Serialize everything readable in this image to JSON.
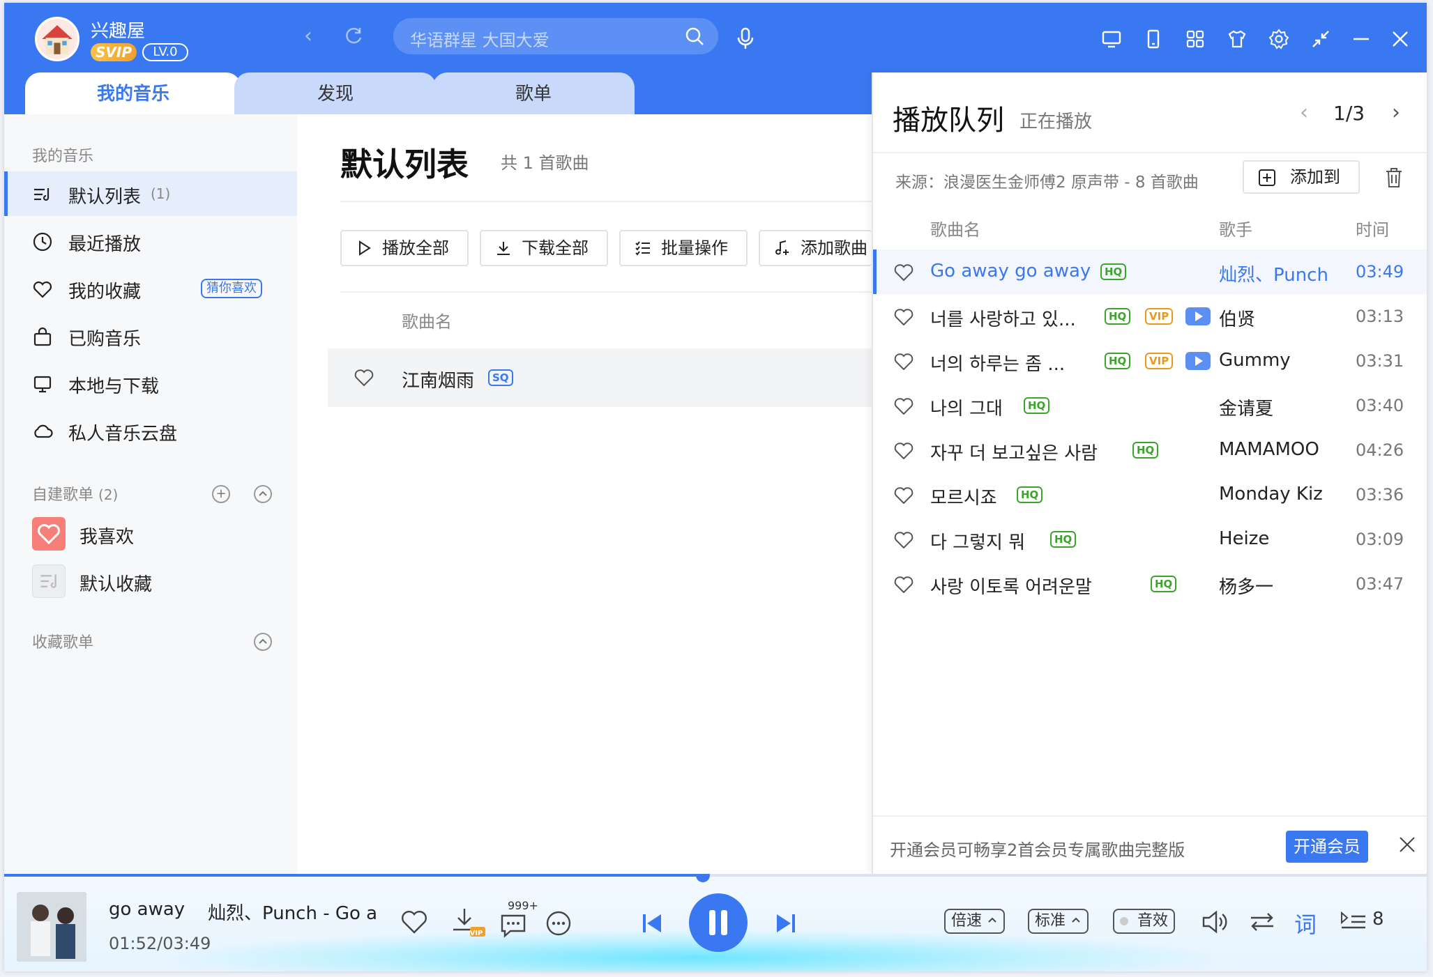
{
  "user": {
    "name": "兴趣屋",
    "svip": "SVIP",
    "level": "LV.0"
  },
  "search": {
    "placeholder": "华语群星 大国大爱"
  },
  "tabs": [
    {
      "label": "我的音乐"
    },
    {
      "label": "发现"
    },
    {
      "label": "歌单"
    }
  ],
  "sidebar": {
    "section_label": "我的音乐",
    "items": [
      {
        "label": "默认列表",
        "count": "(1)"
      },
      {
        "label": "最近播放"
      },
      {
        "label": "我的收藏",
        "tag": "猜你喜欢"
      },
      {
        "label": "已购音乐"
      },
      {
        "label": "本地与下载"
      },
      {
        "label": "私人音乐云盘"
      }
    ],
    "custom_label": "自建歌单",
    "custom_count": "(2)",
    "playlists": [
      {
        "label": "我喜欢"
      },
      {
        "label": "默认收藏"
      }
    ],
    "collected_label": "收藏歌单"
  },
  "main": {
    "title": "默认列表",
    "count": "共 1 首歌曲",
    "actions": [
      "播放全部",
      "下载全部",
      "批量操作",
      "添加歌曲"
    ],
    "column_name": "歌曲名",
    "songs": [
      {
        "name": "江南烟雨",
        "quality": "SQ"
      }
    ]
  },
  "queue": {
    "title": "播放队列",
    "subtitle": "正在播放",
    "page": "1/3",
    "source": "来源：浪漫医生金师傅2 原声带 - 8 首歌曲",
    "add_label": "添加到",
    "col_name": "歌曲名",
    "col_artist": "歌手",
    "col_time": "时间",
    "rows": [
      {
        "name": "Go away go away",
        "artist": "灿烈、Punch",
        "time": "03:49",
        "hq": "HQ",
        "playing": true
      },
      {
        "name": "너를 사랑하고 있...",
        "artist": "伯贤",
        "time": "03:13",
        "hq": "HQ",
        "vip": "VIP",
        "mv": true
      },
      {
        "name": "너의 하루는 좀 ...",
        "artist": "Gummy",
        "time": "03:31",
        "hq": "HQ",
        "vip": "VIP",
        "mv": true
      },
      {
        "name": "나의 그대",
        "artist": "金请夏",
        "time": "03:40",
        "hq": "HQ"
      },
      {
        "name": "자꾸 더 보고싶은 사람",
        "artist": "MAMAMOO",
        "time": "04:26",
        "hq": "HQ"
      },
      {
        "name": "모르시죠",
        "artist": "Monday Kiz",
        "time": "03:36",
        "hq": "HQ"
      },
      {
        "name": "다 그렇지 뭐",
        "artist": "Heize",
        "time": "03:09",
        "hq": "HQ"
      },
      {
        "name": "사랑 이토록 어려운말",
        "artist": "杨多一",
        "time": "03:47",
        "hq": "HQ"
      }
    ],
    "vip_notice": "开通会员可畅享2首会员专属歌曲完整版",
    "vip_button": "开通会员"
  },
  "player": {
    "title": "go away",
    "artist": "灿烈、Punch - Go a",
    "time": "01:52/03:49",
    "progress": 0.491,
    "buffered": 0.27,
    "vip_mark": "VIP",
    "comments": "999+",
    "speed": "倍速",
    "quality": "标准",
    "effect": "音效",
    "lyrics": "词",
    "queue_count": "8"
  },
  "colors": {
    "accent": "#3a78f2",
    "hq": "#3aa52a",
    "vip": "#e89a1a"
  }
}
